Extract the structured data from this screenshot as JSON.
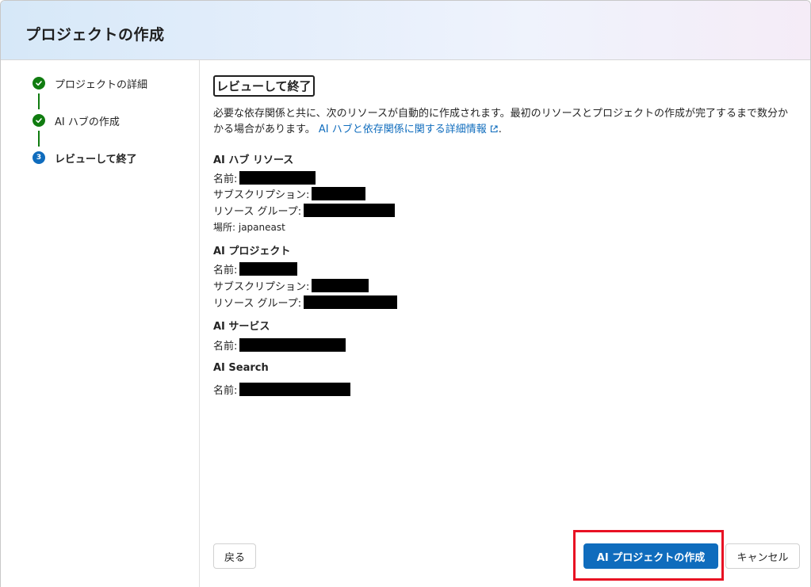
{
  "dialog": {
    "title": "プロジェクトの作成"
  },
  "steps": [
    {
      "label": "プロジェクトの詳細",
      "state": "done"
    },
    {
      "label": "AI ハブの作成",
      "state": "done"
    },
    {
      "label": "レビューして終了",
      "state": "current",
      "number": "3"
    }
  ],
  "main": {
    "heading": "レビューして終了",
    "intro_text": "必要な依存関係と共に、次のリソースが自動的に作成されます。最初のリソースとプロジェクトの作成が完了するまで数分かかる場合があります。",
    "intro_link": "AI ハブと依存関係に関する詳細情報",
    "intro_suffix": ".",
    "hub": {
      "title": "AI ハブ リソース",
      "name_label": "名前:",
      "subscription_label": "サブスクリプション:",
      "resource_group_label": "リソース グループ:",
      "location_label": "場所: japaneast"
    },
    "project": {
      "title": "AI プロジェクト",
      "name_label": "名前:",
      "subscription_label": "サブスクリプション:",
      "resource_group_label": "リソース グループ:"
    },
    "services": {
      "title": "AI サービス",
      "name_label": "名前:"
    },
    "search": {
      "title": "AI Search",
      "name_label": "名前:"
    }
  },
  "buttons": {
    "back": "戻る",
    "create": "AI プロジェクトの作成",
    "cancel": "キャンセル"
  },
  "colors": {
    "primary": "#0f6cbd",
    "success": "#107c10",
    "highlight": "#e81123"
  }
}
